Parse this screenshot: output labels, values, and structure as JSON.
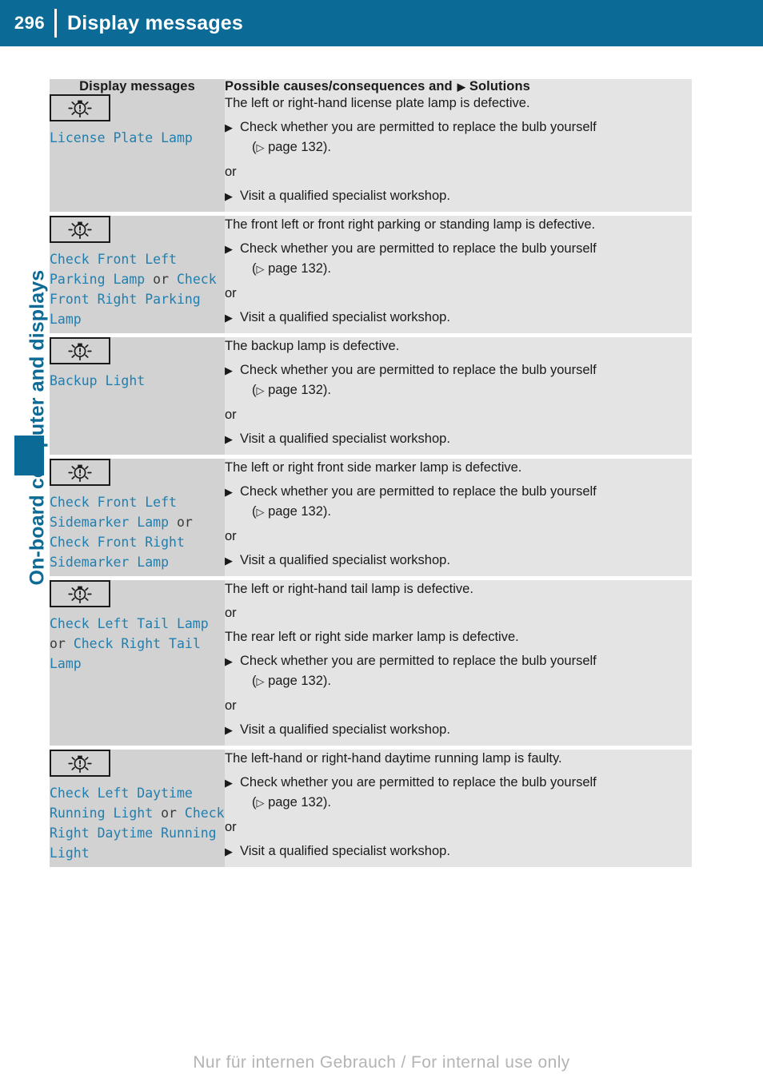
{
  "header": {
    "page_number": "296",
    "title": "Display messages"
  },
  "sidebar": {
    "chapter_label": "On-board computer and displays"
  },
  "table": {
    "columns": {
      "left_header": "Display messages",
      "right_header_pre": "Possible causes/consequences and",
      "right_header_marker": "▶",
      "right_header_post": "Solutions"
    },
    "rows": [
      {
        "icon": "lamp-defect-icon",
        "message_parts": [
          {
            "text": "License Plate Lamp",
            "style": "blue"
          }
        ],
        "causes": [
          "The left or right-hand license plate lamp is defective."
        ],
        "steps": [
          {
            "bullet": "▶",
            "text": "Check whether you are permitted to replace the bulb yourself",
            "ref_prefix": "(",
            "ref_marker": "▷",
            "ref_text": "page 132).",
            "or_after": "or"
          },
          {
            "bullet": "▶",
            "text": "Visit a qualified specialist workshop.",
            "ref_prefix": "",
            "ref_marker": "",
            "ref_text": "",
            "or_after": ""
          }
        ]
      },
      {
        "icon": "lamp-defect-icon",
        "message_parts": [
          {
            "text": "Check Front Left Parking Lamp ",
            "style": "blue"
          },
          {
            "text": "or ",
            "style": "plain"
          },
          {
            "text": "Check Front Right Parking Lamp",
            "style": "blue"
          }
        ],
        "causes": [
          "The front left or front right parking or standing lamp is defective."
        ],
        "steps": [
          {
            "bullet": "▶",
            "text": "Check whether you are permitted to replace the bulb yourself",
            "ref_prefix": "(",
            "ref_marker": "▷",
            "ref_text": "page 132).",
            "or_after": "or"
          },
          {
            "bullet": "▶",
            "text": "Visit a qualified specialist workshop.",
            "ref_prefix": "",
            "ref_marker": "",
            "ref_text": "",
            "or_after": ""
          }
        ]
      },
      {
        "icon": "lamp-defect-icon",
        "message_parts": [
          {
            "text": "Backup Light",
            "style": "blue"
          }
        ],
        "causes": [
          "The backup lamp is defective."
        ],
        "steps": [
          {
            "bullet": "▶",
            "text": "Check whether you are permitted to replace the bulb yourself",
            "ref_prefix": "(",
            "ref_marker": "▷",
            "ref_text": "page 132).",
            "or_after": "or"
          },
          {
            "bullet": "▶",
            "text": "Visit a qualified specialist workshop.",
            "ref_prefix": "",
            "ref_marker": "",
            "ref_text": "",
            "or_after": ""
          }
        ]
      },
      {
        "icon": "lamp-defect-icon",
        "message_parts": [
          {
            "text": "Check Front Left Sidemarker Lamp ",
            "style": "blue"
          },
          {
            "text": "or ",
            "style": "plain"
          },
          {
            "text": "Check Front Right Sidemarker Lamp",
            "style": "blue"
          }
        ],
        "causes": [
          "The left or right front side marker lamp is defective."
        ],
        "steps": [
          {
            "bullet": "▶",
            "text": "Check whether you are permitted to replace the bulb yourself",
            "ref_prefix": "(",
            "ref_marker": "▷",
            "ref_text": "page 132).",
            "or_after": "or"
          },
          {
            "bullet": "▶",
            "text": "Visit a qualified specialist workshop.",
            "ref_prefix": "",
            "ref_marker": "",
            "ref_text": "",
            "or_after": ""
          }
        ]
      },
      {
        "icon": "lamp-defect-icon",
        "message_parts": [
          {
            "text": "Check Left Tail Lamp ",
            "style": "blue"
          },
          {
            "text": "or ",
            "style": "plain"
          },
          {
            "text": "Check Right Tail Lamp",
            "style": "blue"
          }
        ],
        "causes": [
          "The left or right-hand tail lamp is defective.",
          "or",
          "The rear left or right side marker lamp is defective."
        ],
        "steps": [
          {
            "bullet": "▶",
            "text": "Check whether you are permitted to replace the bulb yourself",
            "ref_prefix": "(",
            "ref_marker": "▷",
            "ref_text": "page 132).",
            "or_after": "or"
          },
          {
            "bullet": "▶",
            "text": "Visit a qualified specialist workshop.",
            "ref_prefix": "",
            "ref_marker": "",
            "ref_text": "",
            "or_after": ""
          }
        ]
      },
      {
        "icon": "lamp-defect-icon",
        "message_parts": [
          {
            "text": "Check Left Daytime Running Light ",
            "style": "blue"
          },
          {
            "text": "or ",
            "style": "plain"
          },
          {
            "text": "Check Right Daytime Running Light",
            "style": "blue"
          }
        ],
        "causes": [
          "The left-hand or right-hand daytime running lamp is faulty."
        ],
        "steps": [
          {
            "bullet": "▶",
            "text": "Check whether you are permitted to replace the bulb yourself",
            "ref_prefix": "(",
            "ref_marker": "▷",
            "ref_text": "page 132).",
            "or_after": "or"
          },
          {
            "bullet": "▶",
            "text": "Visit a qualified specialist workshop.",
            "ref_prefix": "",
            "ref_marker": "",
            "ref_text": "",
            "or_after": ""
          }
        ]
      }
    ]
  },
  "footer": {
    "watermark": "Nur für internen Gebrauch / For internal use only"
  },
  "colors": {
    "brand_blue": "#0b6a96",
    "message_blue": "#1f7fb0",
    "left_cell_bg": "#d2d2d2",
    "right_cell_bg": "#e4e4e4",
    "text_dark": "#1a1a1a",
    "watermark_gray": "#b4b4b4"
  }
}
